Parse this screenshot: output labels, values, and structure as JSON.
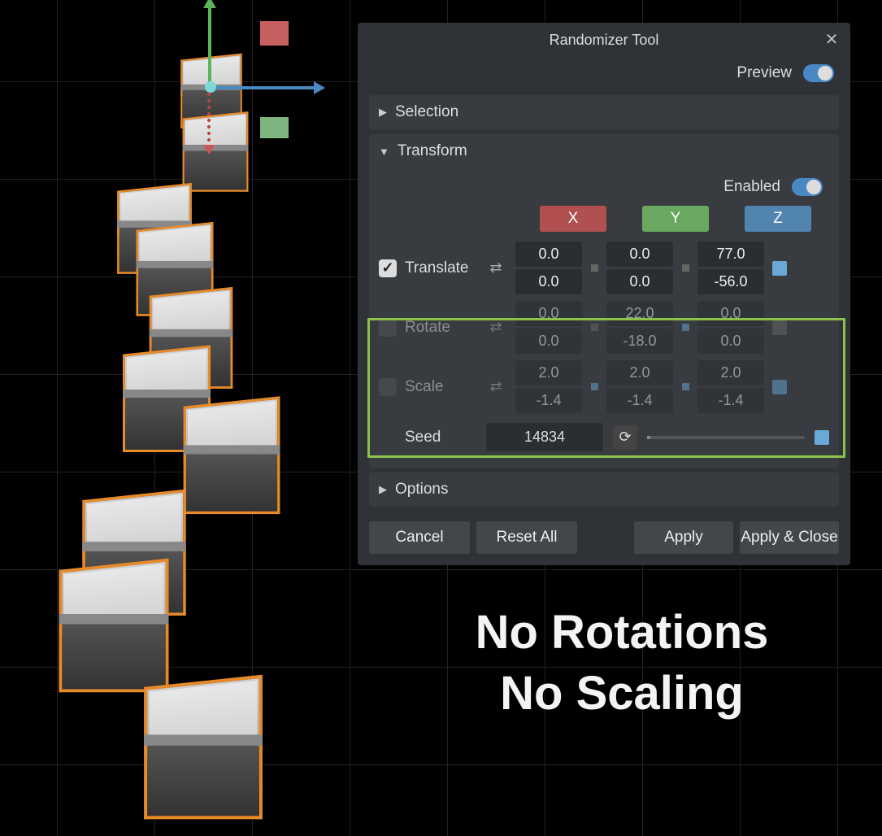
{
  "panel": {
    "title": "Randomizer Tool",
    "preview_label": "Preview",
    "preview_on": true,
    "sections": {
      "selection": {
        "label": "Selection",
        "expanded": false
      },
      "transform": {
        "label": "Transform",
        "expanded": true,
        "enabled_label": "Enabled",
        "enabled": true,
        "axes": {
          "x": "X",
          "y": "Y",
          "z": "Z"
        },
        "rows": {
          "translate": {
            "label": "Translate",
            "checked": true,
            "x": {
              "top": "0.0",
              "bot": "0.0"
            },
            "y": {
              "top": "0.0",
              "bot": "0.0"
            },
            "z": {
              "top": "77.0",
              "bot": "-56.0"
            }
          },
          "rotate": {
            "label": "Rotate",
            "checked": false,
            "x": {
              "top": "0.0",
              "bot": "0.0"
            },
            "y": {
              "top": "22.0",
              "bot": "-18.0"
            },
            "z": {
              "top": "0.0",
              "bot": "0.0"
            }
          },
          "scale": {
            "label": "Scale",
            "checked": false,
            "x": {
              "top": "2.0",
              "bot": "-1.4"
            },
            "y": {
              "top": "2.0",
              "bot": "-1.4"
            },
            "z": {
              "top": "2.0",
              "bot": "-1.4"
            }
          }
        },
        "seed": {
          "label": "Seed",
          "value": "14834"
        }
      },
      "options": {
        "label": "Options",
        "expanded": false
      }
    },
    "buttons": {
      "cancel": "Cancel",
      "reset": "Reset All",
      "apply": "Apply",
      "apply_close": "Apply & Close"
    }
  },
  "annotation": {
    "line1": "No Rotations",
    "line2": "No Scaling"
  }
}
